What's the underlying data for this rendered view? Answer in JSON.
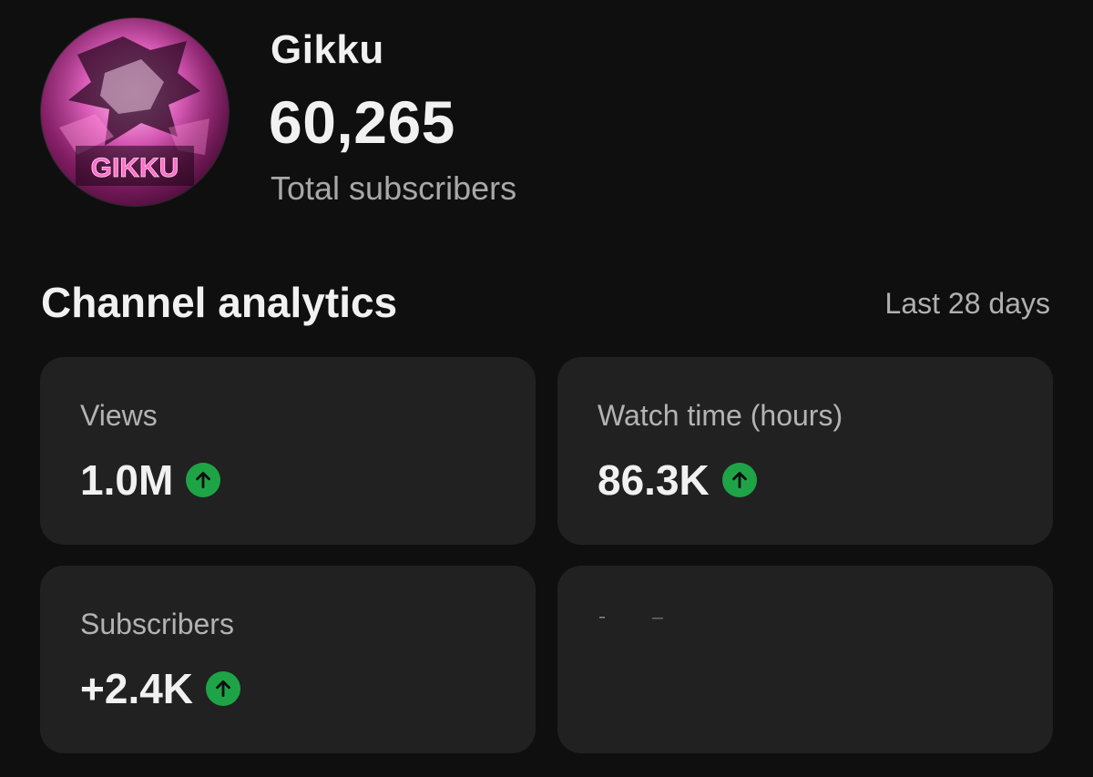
{
  "channel": {
    "name": "Gikku",
    "subscriber_count": "60,265",
    "subscriber_label": "Total subscribers",
    "avatar_text": "GIKKU"
  },
  "analytics": {
    "title": "Channel analytics",
    "period": "Last 28 days",
    "cards": [
      {
        "label": "Views",
        "value": "1.0M",
        "trend": "up",
        "trend_icon": "arrow-up-icon"
      },
      {
        "label": "Watch time (hours)",
        "value": "86.3K",
        "trend": "up",
        "trend_icon": "arrow-up-icon"
      },
      {
        "label": "Subscribers",
        "value": "+2.4K",
        "trend": "up",
        "trend_icon": "arrow-up-icon"
      },
      {
        "label": "",
        "value": ""
      }
    ]
  },
  "colors": {
    "background": "#0f0f0f",
    "card": "#212121",
    "trend_up": "#1ea446",
    "avatar_accent": "#d85bb5"
  }
}
